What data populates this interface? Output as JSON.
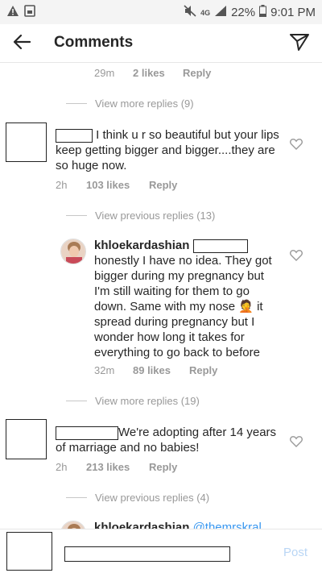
{
  "status_bar": {
    "network": "4G",
    "battery_percent": "22%",
    "time": "9:01 PM",
    "icons": [
      "warning-icon",
      "screenshot-icon",
      "mute-icon",
      "signal-icon",
      "battery-icon"
    ]
  },
  "header": {
    "title": "Comments",
    "back_icon": "arrow-left-icon",
    "share_icon": "send-icon"
  },
  "comments": {
    "top_meta": {
      "time": "29m",
      "likes": "2 likes",
      "reply": "Reply"
    },
    "more_replies_1": "View more replies (9)",
    "c1": {
      "text": " I think u r so beautiful but your lips keep getting bigger and bigger....they are so huge now.",
      "time": "2h",
      "likes": "103 likes",
      "reply": "Reply"
    },
    "previous_replies_1": "View previous replies (13)",
    "khloe_reply": {
      "username": "khloekardashian",
      "text": "honestly I have no idea. They got bigger during my pregnancy but I'm still waiting for them to go down. Same with my nose 🤦 it spread during pregnancy but I wonder how long it takes for everything to go back to before",
      "time": "32m",
      "likes": "89 likes",
      "reply": "Reply"
    },
    "more_replies_2": "View more replies (19)",
    "c2": {
      "text": "We're adopting after 14 years of marriage and no babies!",
      "time": "2h",
      "likes": "213 likes",
      "reply": "Reply"
    },
    "previous_replies_2": "View previous replies (4)",
    "khloe_reply_2": {
      "username": "khloekardashian",
      "mention": "@themrskral"
    }
  },
  "composer": {
    "post_label": "Post"
  },
  "colors": {
    "link_blue": "#3897f0",
    "muted": "#999999",
    "post_disabled": "#b9d6f5"
  }
}
